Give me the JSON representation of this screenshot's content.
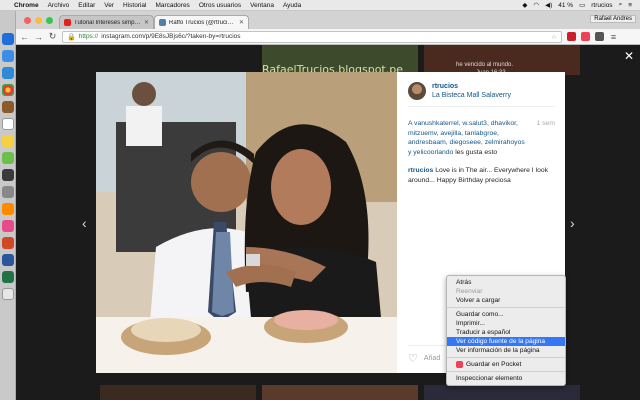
{
  "menubar": {
    "app": "Chrome",
    "items": [
      "Archivo",
      "Editar",
      "Ver",
      "Historial",
      "Marcadores",
      "Otros usuarios",
      "Ventana",
      "Ayuda"
    ],
    "battery": "41 %",
    "user": "rtrucios"
  },
  "browser": {
    "tabs": [
      {
        "label": "Tutorial Intereses simple y co"
      },
      {
        "label": "Raffo Trucios (@rtrucios) e..."
      }
    ],
    "profile": "Rafael Andres",
    "url_scheme": "https://",
    "url_rest": "instagram.com/p/9E8sJBjs6c/?taken-by=rtrucios"
  },
  "background": {
    "banner": "RafaelTrucios.blogspot.pe",
    "note_line1": "he vencido al mundo.",
    "note_line2": "Juan 16:33"
  },
  "post": {
    "username": "rtrucios",
    "location": "La Bisteca Mall Salaverry",
    "likes_users": "A vanushkaterrel, w.salut3, dhavikor, mitzuemv, avejilla, tanlabgroe, andresbaam, diegoseee, zelmirahoyos y yelicoorlando",
    "likes_suffix": "les gusta esto",
    "time_ago": "1 sem",
    "caption_user": "rtrucios",
    "caption_text": "Love is in The air... Everywhere I look around... Happy Birthday preciosa",
    "add_comment": "Añad"
  },
  "context_menu": {
    "items": [
      {
        "label": "Atrás",
        "disabled": false
      },
      {
        "label": "Reenviar",
        "disabled": true
      },
      {
        "label": "Volver a cargar",
        "disabled": false
      },
      {
        "label": "Guardar como...",
        "disabled": false
      },
      {
        "label": "Imprimir...",
        "disabled": false
      },
      {
        "label": "Traducir a español",
        "disabled": false
      },
      {
        "label": "Ver código fuente de la página",
        "highlighted": true
      },
      {
        "label": "Ver información de la página",
        "disabled": false
      },
      {
        "label": "Guardar en Pocket",
        "disabled": false
      },
      {
        "label": "Inspeccionar elemento",
        "disabled": false
      }
    ]
  },
  "colors": {
    "link": "#125688",
    "highlight": "#3478f6",
    "secure": "#1d8c2e"
  }
}
